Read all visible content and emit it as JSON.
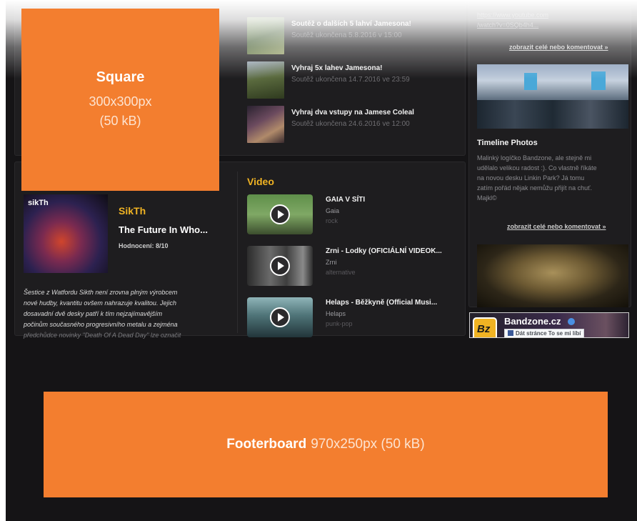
{
  "ads": {
    "square": {
      "name": "Square",
      "size": "300x300px",
      "weight": "(50 kB)"
    },
    "footer": {
      "name": "Footerboard",
      "rest": "970x250px (50 kB)"
    }
  },
  "contests": [
    {
      "title": "Soutěž o dalších 5 lahví Jamesona!",
      "date": "Soutěž ukončena 5.8.2016 v 15:00"
    },
    {
      "title": "Vyhraj 5x lahev Jamesona!",
      "date": "Soutěž ukončena 14.7.2016 ve 23:59"
    },
    {
      "title": "Vyhraj dva vstupy na Jamese Coleal",
      "date": "Soutěž ukončena 24.6.2016 ve 12:00"
    }
  ],
  "right": {
    "url_lines": [
      "https://www.youtube.com",
      "/watch?v=0SQb4h4..."
    ],
    "show_more_1": "zobrazit celé nebo komentovat »",
    "photos_title": "Timeline Photos",
    "photos_text": [
      "Malinký logíčko Bandzone, ale stejně mi",
      "udělalo velikou radost :). Co vlastně říkáte",
      "na novou desku Linkin Park? Já tomu",
      "zatím pořád nějak nemůžu přijít na chuť.",
      "Majkl©"
    ],
    "show_more_2": "zobrazit celé nebo komentovat »",
    "fb": {
      "name": "Bandzone.cz",
      "like": "Dát stránce To se mi líbí",
      "logo": "Bz"
    }
  },
  "album": {
    "cover_text": "sikTh",
    "artist": "SikTh",
    "title": "The Future In Who...",
    "rating": "Hodnocení: 8/10",
    "text": [
      "Šestice z Watfordu Sikth není zrovna plným výrobcem",
      "nové hudby, kvantitu ovšem nahrazuje kvalitou. Jejich",
      "dosavadní dvě desky patří k tím nejzajímavějším",
      "počinům současného progresivního metalu a zejména",
      "předchůdce novinky \"Death Of A Dead Day\" lze označit"
    ]
  },
  "video_section": {
    "heading": "Video",
    "items": [
      {
        "title": "GAIA V SÍTI",
        "artist": "Gaia",
        "genre": "rock"
      },
      {
        "title": "Zrni - Lodky (OFICIÁLNÍ VIDEOK...",
        "artist": "Zrni",
        "genre": "alternative"
      },
      {
        "title": "Helaps - Běžkyně (Official Musi...",
        "artist": "Helaps",
        "genre": "punk-pop"
      }
    ]
  },
  "colors": {
    "accent": "#f0b323",
    "ad_orange": "#f37e2f",
    "background": "#151416",
    "facebook": "#3b5998"
  }
}
